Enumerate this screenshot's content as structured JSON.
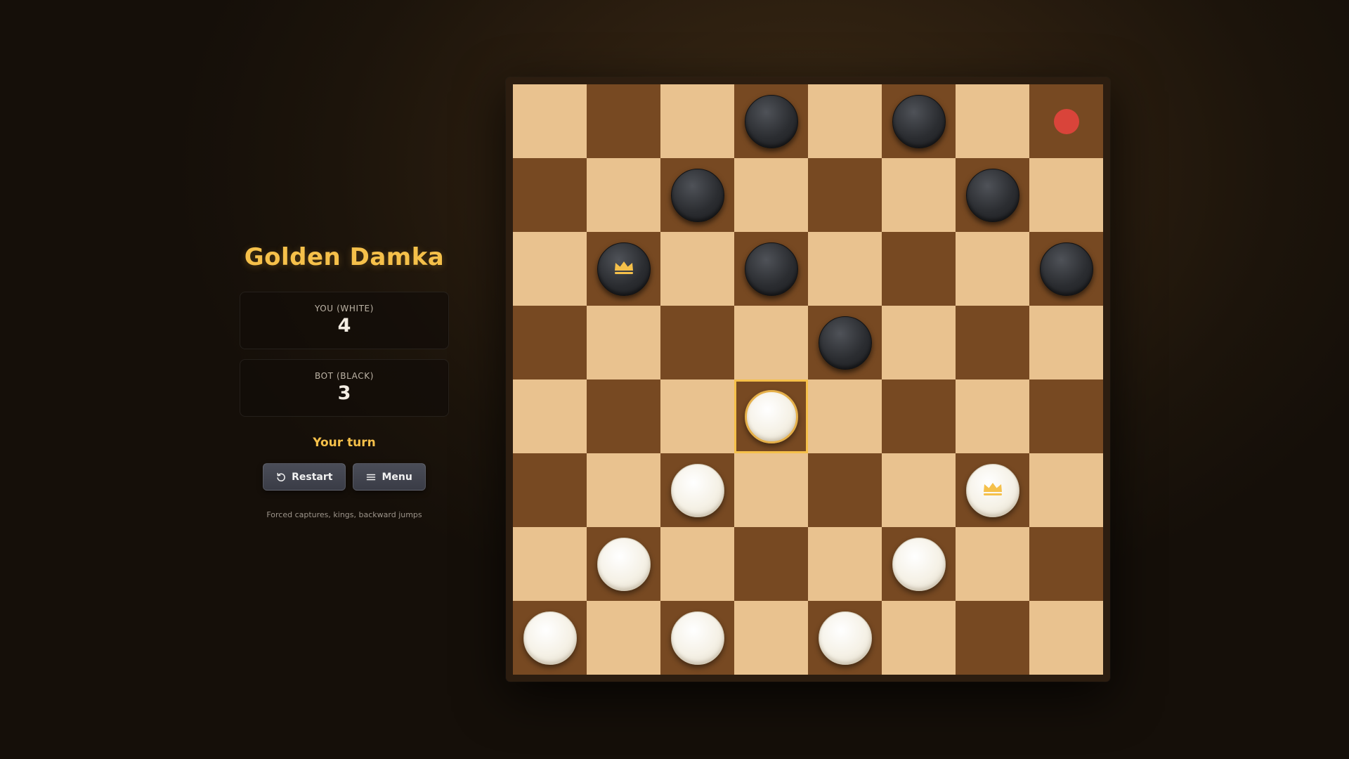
{
  "app": {
    "title": "Golden Damka"
  },
  "scores": {
    "you": {
      "label": "YOU (WHITE)",
      "value": "4"
    },
    "bot": {
      "label": "BOT (BLACK)",
      "value": "3"
    }
  },
  "status": "Your turn",
  "buttons": {
    "restart": {
      "label": "Restart",
      "icon": "restart-icon"
    },
    "menu": {
      "label": "Menu",
      "icon": "menu-icon"
    }
  },
  "rules_text": "Forced captures, kings, backward jumps",
  "colors": {
    "accent": "#f5c04a",
    "light_square": "#e9c28f",
    "dark_square": "#774922",
    "marker": "#d9443a"
  },
  "board": {
    "size": 8,
    "selected": {
      "row": 4,
      "col": 3
    },
    "pieces": [
      {
        "row": 0,
        "col": 3,
        "color": "black",
        "king": false
      },
      {
        "row": 0,
        "col": 5,
        "color": "black",
        "king": false
      },
      {
        "row": 1,
        "col": 2,
        "color": "black",
        "king": false
      },
      {
        "row": 1,
        "col": 6,
        "color": "black",
        "king": false
      },
      {
        "row": 2,
        "col": 1,
        "color": "black",
        "king": true
      },
      {
        "row": 2,
        "col": 3,
        "color": "black",
        "king": false
      },
      {
        "row": 2,
        "col": 7,
        "color": "black",
        "king": false
      },
      {
        "row": 3,
        "col": 4,
        "color": "black",
        "king": false
      },
      {
        "row": 4,
        "col": 3,
        "color": "white",
        "king": false
      },
      {
        "row": 5,
        "col": 2,
        "color": "white",
        "king": false
      },
      {
        "row": 5,
        "col": 6,
        "color": "white",
        "king": true
      },
      {
        "row": 6,
        "col": 1,
        "color": "white",
        "king": false
      },
      {
        "row": 6,
        "col": 5,
        "color": "white",
        "king": false
      },
      {
        "row": 7,
        "col": 0,
        "color": "white",
        "king": false
      },
      {
        "row": 7,
        "col": 2,
        "color": "white",
        "king": false
      },
      {
        "row": 7,
        "col": 4,
        "color": "white",
        "king": false
      }
    ],
    "markers": [
      {
        "row": 0,
        "col": 7
      }
    ]
  }
}
